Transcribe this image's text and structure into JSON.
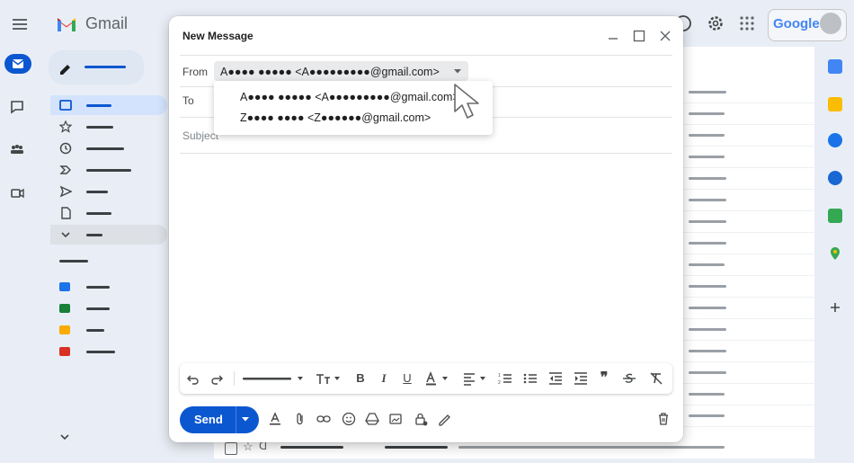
{
  "app": {
    "brand": "Gmail",
    "google_badge": "Google"
  },
  "compose": {
    "title": "New Message",
    "from_label": "From",
    "from_value": "A●●●● ●●●●● <A●●●●●●●●●@gmail.com>",
    "to_label": "To",
    "subject_placeholder": "Subject",
    "send_label": "Send",
    "from_options": [
      "A●●●● ●●●●● <A●●●●●●●●●@gmail.com>",
      "Z●●●● ●●●● <Z●●●●●●@gmail.com>"
    ]
  },
  "colors": {
    "accent": "#0b57d0",
    "background": "#e9eef6",
    "selected_nav": "#d3e3fd",
    "label_blue": "#1a73e8",
    "label_green": "#188038",
    "label_yellow": "#f9ab00",
    "label_red": "#d93025"
  },
  "icons": {
    "top": [
      "menu-icon",
      "gmail-logo-icon",
      "help-icon",
      "settings-icon",
      "apps-grid-icon",
      "avatar"
    ],
    "rail": [
      "mail-icon",
      "chat-icon",
      "spaces-icon",
      "meet-icon"
    ],
    "nav": [
      "inbox-icon",
      "star-icon",
      "clock-icon",
      "important-icon",
      "sent-icon",
      "draft-icon",
      "chevron-down-icon"
    ],
    "side_panel": [
      "calendar-icon",
      "keep-icon",
      "tasks-icon",
      "contacts-icon",
      "voice-icon",
      "maps-icon",
      "plus-icon"
    ],
    "format": [
      "undo-icon",
      "redo-icon",
      "font-icon",
      "font-size-icon",
      "bold-icon",
      "italic-icon",
      "underline-icon",
      "text-color-icon",
      "align-icon",
      "numbered-list-icon",
      "bulleted-list-icon",
      "indent-less-icon",
      "indent-more-icon",
      "quote-icon",
      "strikethrough-icon",
      "remove-formatting-icon"
    ],
    "actions": [
      "format-options-icon",
      "attach-icon",
      "link-icon",
      "emoji-icon",
      "drive-icon",
      "photo-icon",
      "confidential-icon",
      "signature-icon",
      "trash-icon"
    ]
  }
}
